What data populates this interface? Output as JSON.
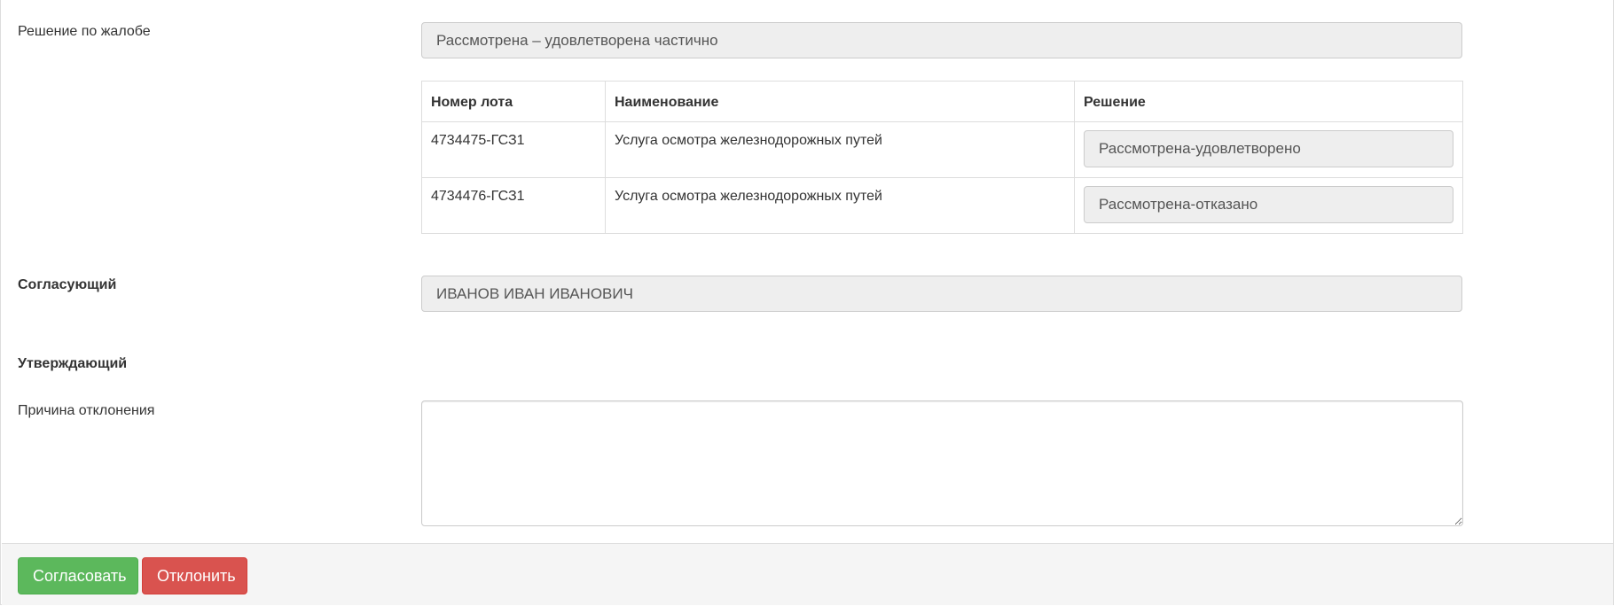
{
  "complaint_decision": {
    "label": "Решение по жалобе",
    "value": "Рассмотрена – удовлетворена частично"
  },
  "lots_table": {
    "headers": [
      "Номер лота",
      "Наименование",
      "Решение"
    ],
    "rows": [
      {
        "lot_number": "4734475-ГСЗ1",
        "name": "Услуга осмотра железнодорожных путей",
        "decision": "Рассмотрена-удовлетворено"
      },
      {
        "lot_number": "4734476-ГСЗ1",
        "name": "Услуга осмотра железнодорожных путей",
        "decision": "Рассмотрена-отказано"
      }
    ]
  },
  "approver": {
    "label": "Согласующий",
    "value": "ИВАНОВ ИВАН ИВАНОВИЧ"
  },
  "confirmer": {
    "label": "Утверждающий"
  },
  "rejection_reason": {
    "label": "Причина отклонения",
    "value": ""
  },
  "actions": {
    "approve_label": "Согласовать",
    "reject_label": "Отклонить"
  },
  "colors": {
    "approve": "#5cb85c",
    "reject": "#d9534f",
    "readonly_bg": "#eeeeee",
    "footer_bg": "#f5f5f5"
  }
}
